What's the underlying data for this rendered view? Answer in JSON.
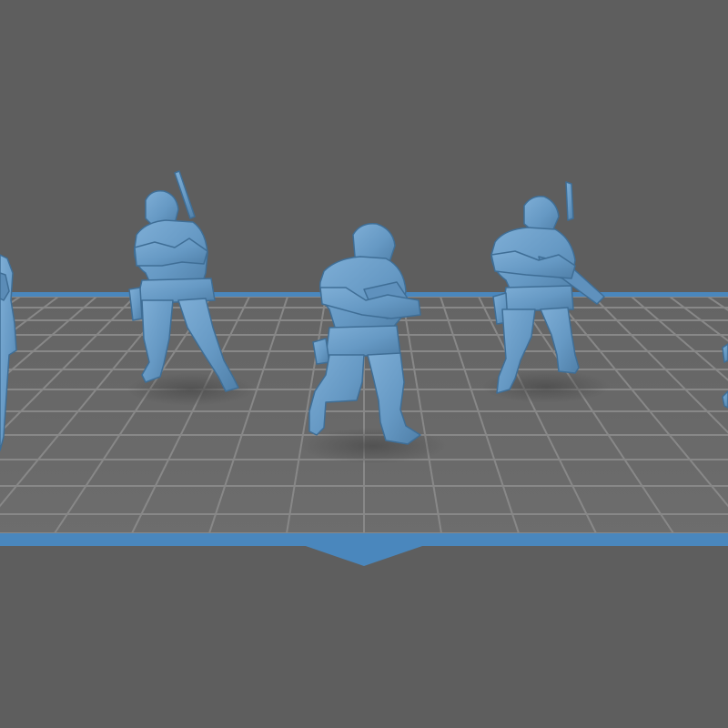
{
  "viewport": {
    "background_color": "#5e5e5e",
    "plate_color": "#6a6a6a",
    "grid_line_color": "#8a8a8a",
    "border_color": "#4a87bd",
    "model_color": "#6a9cc8"
  },
  "models": [
    {
      "name": "soldier-figure-far-left",
      "partially_visible": true
    },
    {
      "name": "soldier-figure-left"
    },
    {
      "name": "soldier-figure-center"
    },
    {
      "name": "soldier-figure-right"
    },
    {
      "name": "soldier-figure-far-right",
      "partially_visible": true
    }
  ],
  "icons": {
    "front_indicator": "front-arrow-icon"
  }
}
